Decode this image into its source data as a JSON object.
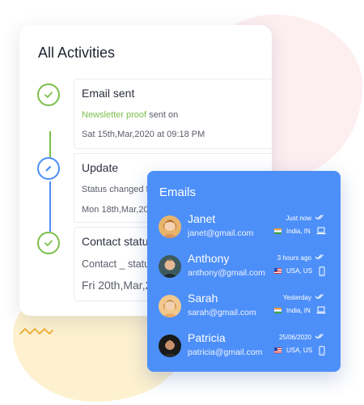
{
  "activities": {
    "title": "All Activities",
    "items": [
      {
        "title": "Email sent",
        "highlight": "Newsletter proof",
        "text": " sent on",
        "date": "Sat 15th,Mar,2020 at 09:18 PM",
        "icon": "check-icon",
        "color": "#7bbf4a"
      },
      {
        "title": "Update",
        "text": "Status changed f",
        "date": "Mon 18th,Mar,20",
        "icon": "pencil-icon",
        "color": "#4d8ff8"
      },
      {
        "title": "Contact status",
        "highlight": "Contact _ statu",
        "date": "Fri 20th,Mar,2",
        "icon": "check-icon",
        "color": "#7bbf4a"
      }
    ]
  },
  "emails": {
    "title": "Emails",
    "items": [
      {
        "name": "Janet",
        "email": "janet@gmail.com",
        "time": "Just now",
        "location": "India, IN",
        "flag": "india-flag",
        "device": "laptop-icon"
      },
      {
        "name": "Anthony",
        "email": "anthony@gmail.com",
        "time": "3 hours ago",
        "location": "USA, US",
        "flag": "usa-flag",
        "device": "phone-icon"
      },
      {
        "name": "Sarah",
        "email": "sarah@gmail.com",
        "time": "Yesterday",
        "location": "India, IN",
        "flag": "india-flag",
        "device": "laptop-icon"
      },
      {
        "name": "Patricia",
        "email": "patricia@gmail.com",
        "time": "25/06/2020",
        "location": "USA, US",
        "flag": "usa-flag",
        "device": "phone-icon"
      }
    ]
  },
  "colors": {
    "primary": "#4d8ff8",
    "success": "#7bbf4a",
    "pink_blob": "#fdeef0",
    "yellow_blob": "#fdf1cf"
  }
}
